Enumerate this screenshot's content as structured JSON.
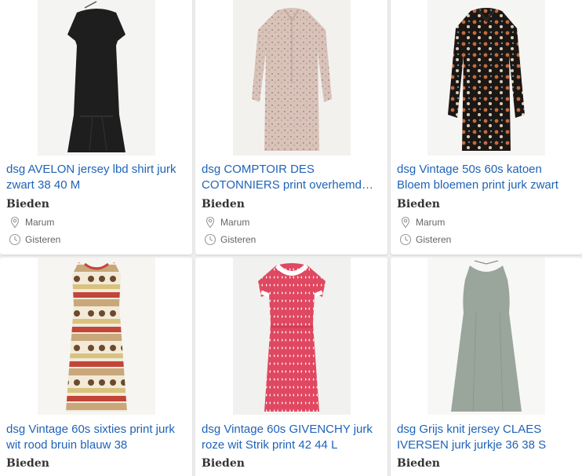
{
  "listings": [
    {
      "title": "dsg AVELON jersey lbd shirt jurk zwart 38 40 M",
      "price": "Bieden",
      "location": "Marum",
      "time": "Gisteren",
      "image": "black-jersey-dress"
    },
    {
      "title": "dsg COMPTOIR DES COTONNIERS print overhemd jurk",
      "price": "Bieden",
      "location": "Marum",
      "time": "Gisteren",
      "image": "floral-shirt-dress"
    },
    {
      "title": "dsg Vintage 50s 60s katoen Bloem bloemen print jurk zwart",
      "price": "Bieden",
      "location": "Marum",
      "time": "Gisteren",
      "image": "black-floral-shirt-dress"
    },
    {
      "title": "dsg Vintage 60s sixties print jurk wit rood bruin blauw 38",
      "price": "Bieden",
      "image": "striped-sixties-dress"
    },
    {
      "title": "dsg Vintage 60s GIVENCHY jurk roze wit Strik print 42 44 L",
      "price": "Bieden",
      "image": "pink-bow-print-dress"
    },
    {
      "title": "dsg Grijs knit jersey CLAES IVERSEN jurk jurkje 36 38 S",
      "price": "Bieden",
      "image": "grey-knit-dress"
    }
  ],
  "icons": {
    "location": "location-pin-icon",
    "time": "clock-icon"
  },
  "colors": {
    "title": "#1f63b8",
    "background": "#eeeeee",
    "card": "#ffffff"
  }
}
